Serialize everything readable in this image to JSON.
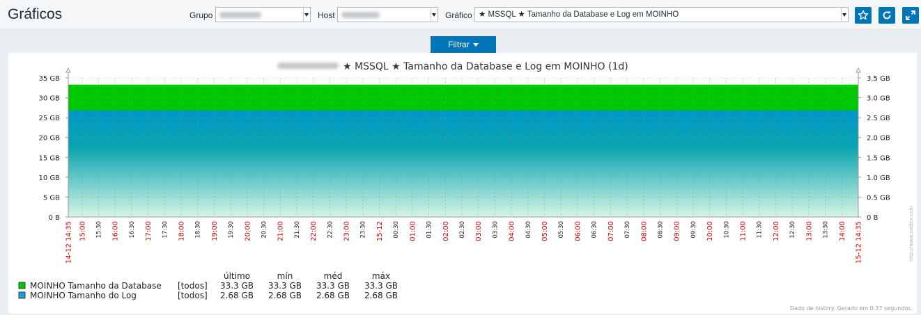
{
  "page": {
    "title": "Gráficos"
  },
  "filters": {
    "group_label": "Grupo",
    "host_label": "Host",
    "graph_label": "Gráfico",
    "graph_value": "★ MSSQL ★ Tamanho da Database e Log em MOINHO"
  },
  "actions": {
    "favorite_icon": "star-icon",
    "refresh_icon": "refresh-icon",
    "fullscreen_icon": "expand-icon"
  },
  "filter_tab": {
    "label": "Filtrar"
  },
  "graph": {
    "title": "★ MSSQL ★ Tamanho da Database e Log em MOINHO (1d)",
    "footer": "Dado de history. Gerado em 0.37 segundos.",
    "watermark": "http://www.zabbix.com"
  },
  "chart_data": {
    "type": "area",
    "title": "★ MSSQL ★ Tamanho da Database e Log em MOINHO (1d)",
    "left_axis": {
      "labels": [
        "0 B",
        "5 GB",
        "10 GB",
        "15 GB",
        "20 GB",
        "25 GB",
        "30 GB",
        "35 GB"
      ],
      "min": 0,
      "max": 35
    },
    "right_axis": {
      "labels": [
        "0 B",
        "0.5 GB",
        "1.0 GB",
        "1.5 GB",
        "2.0 GB",
        "2.5 GB",
        "3.0 GB",
        "3.5 GB"
      ],
      "min": 0,
      "max": 3.5
    },
    "x_ticks": [
      {
        "label": "15:00",
        "red": true
      },
      {
        "label": "15:30",
        "red": false
      },
      {
        "label": "16:00",
        "red": true
      },
      {
        "label": "16:30",
        "red": false
      },
      {
        "label": "17:00",
        "red": true
      },
      {
        "label": "17:30",
        "red": false
      },
      {
        "label": "18:00",
        "red": true
      },
      {
        "label": "18:30",
        "red": false
      },
      {
        "label": "19:00",
        "red": true
      },
      {
        "label": "19:30",
        "red": false
      },
      {
        "label": "20:00",
        "red": true
      },
      {
        "label": "20:30",
        "red": false
      },
      {
        "label": "21:00",
        "red": true
      },
      {
        "label": "21:30",
        "red": false
      },
      {
        "label": "22:00",
        "red": true
      },
      {
        "label": "22:30",
        "red": false
      },
      {
        "label": "23:00",
        "red": true
      },
      {
        "label": "23:30",
        "red": false
      },
      {
        "label": "15-12",
        "red": true
      },
      {
        "label": "00:30",
        "red": false
      },
      {
        "label": "01:00",
        "red": true
      },
      {
        "label": "01:30",
        "red": false
      },
      {
        "label": "02:00",
        "red": true
      },
      {
        "label": "02:30",
        "red": false
      },
      {
        "label": "03:00",
        "red": true
      },
      {
        "label": "03:30",
        "red": false
      },
      {
        "label": "04:00",
        "red": true
      },
      {
        "label": "04:30",
        "red": false
      },
      {
        "label": "05:00",
        "red": true
      },
      {
        "label": "05:30",
        "red": false
      },
      {
        "label": "06:00",
        "red": true
      },
      {
        "label": "06:30",
        "red": false
      },
      {
        "label": "07:00",
        "red": true
      },
      {
        "label": "07:30",
        "red": false
      },
      {
        "label": "08:00",
        "red": true
      },
      {
        "label": "08:30",
        "red": false
      },
      {
        "label": "09:00",
        "red": true
      },
      {
        "label": "09:30",
        "red": false
      },
      {
        "label": "10:00",
        "red": true
      },
      {
        "label": "10:30",
        "red": false
      },
      {
        "label": "11:00",
        "red": true
      },
      {
        "label": "11:30",
        "red": false
      },
      {
        "label": "12:00",
        "red": true
      },
      {
        "label": "12:30",
        "red": false
      },
      {
        "label": "13:00",
        "red": true
      },
      {
        "label": "13:30",
        "red": false
      },
      {
        "label": "14:00",
        "red": true
      }
    ],
    "x_start_label": "14-12 14:35",
    "x_end_label": "15-12 14:35",
    "series": [
      {
        "name": "MOINHO Tamanho da Database",
        "axis": "left",
        "color": "#00c800",
        "value": 33.3,
        "unit": "GB"
      },
      {
        "name": "MOINHO Tamanho do Log",
        "axis": "right",
        "color": "#0099cc",
        "value": 2.68,
        "unit": "GB"
      }
    ],
    "legend": {
      "headers": [
        "último",
        "mín",
        "méd",
        "máx"
      ],
      "rows": [
        {
          "name": "MOINHO Tamanho da Database",
          "color": "#00c800",
          "scope": "[todos]",
          "last": "33.3 GB",
          "min": "33.3 GB",
          "avg": "33.3 GB",
          "max": "33.3 GB"
        },
        {
          "name": "MOINHO Tamanho do Log",
          "color": "#1aa0d6",
          "scope": "[todos]",
          "last": "2.68 GB",
          "min": "2.68 GB",
          "avg": "2.68 GB",
          "max": "2.68 GB"
        }
      ]
    }
  }
}
